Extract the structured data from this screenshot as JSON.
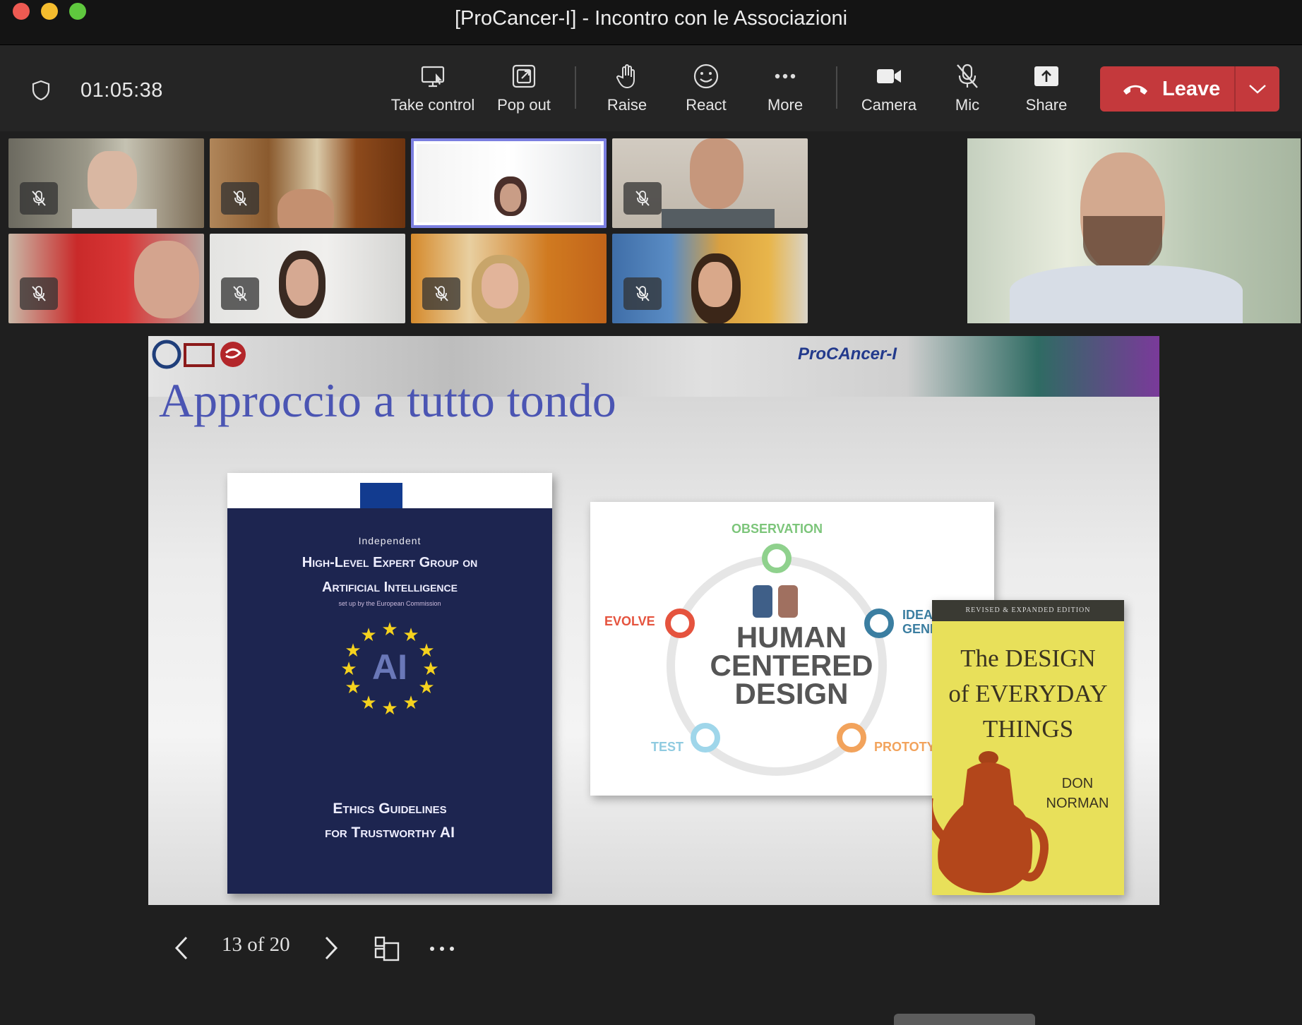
{
  "window": {
    "title": "[ProCancer-I] - Incontro con le Associazioni"
  },
  "toolbar": {
    "timer": "01:05:38",
    "take_control": "Take control",
    "pop_out": "Pop out",
    "raise": "Raise",
    "react": "React",
    "more": "More",
    "camera": "Camera",
    "mic": "Mic",
    "share": "Share",
    "leave": "Leave"
  },
  "participants": {
    "muted_tiles": 7,
    "active_speaker_tile": 3
  },
  "slide": {
    "title": "Approccio a tutto tondo",
    "logo_text": "ProCAncer-I",
    "eu_book": {
      "line1": "Independent",
      "line2": "High-Level Expert Group on",
      "line3": "Artificial Intelligence",
      "line4": "set up by the European Commission",
      "ai": "AI",
      "line5": "Ethics Guidelines",
      "line6": "for Trustworthy AI"
    },
    "hcd": {
      "observation": "OBSERVATION",
      "evolve": "EVOLVE",
      "idea": "IDEA",
      "idea2": "GENI",
      "test": "TEST",
      "prototype": "PROTOTY",
      "big1": "HUMAN",
      "big2": "CENTERED",
      "big3": "DESIGN"
    },
    "book": {
      "edition": "REVISED & EXPANDED EDITION",
      "l1": "The DESIGN",
      "l2": "of EVERYDAY",
      "l3": "THINGS",
      "author1": "DON",
      "author2": "NORMAN"
    }
  },
  "presentation": {
    "page": "13 of 20"
  },
  "colors": {
    "leave": "#c4393c",
    "active_outline": "#7b7fe0",
    "slide_title": "#4b55b3"
  }
}
